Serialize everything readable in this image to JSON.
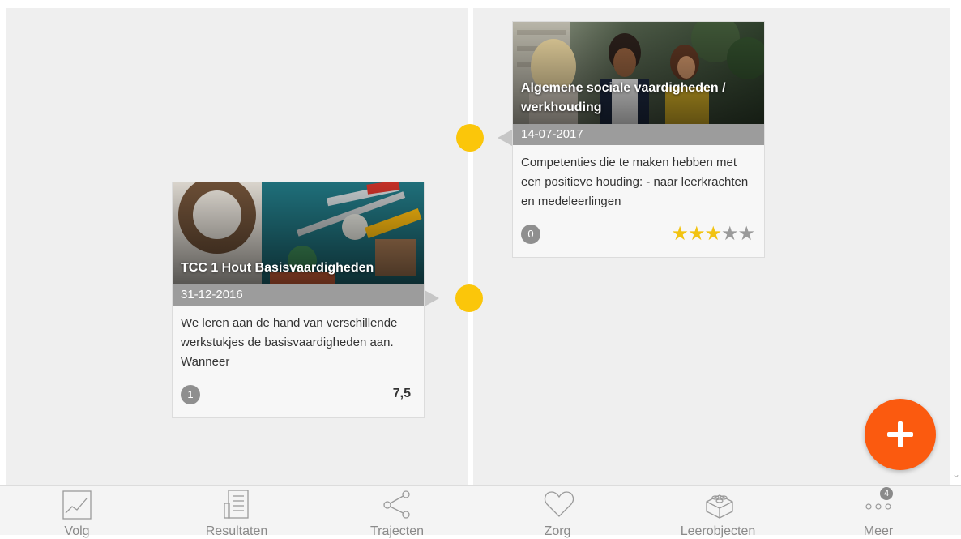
{
  "timeline": {
    "cards": [
      {
        "title": "Algemene sociale vaardigheden / werkhouding",
        "date": "14-07-2017",
        "description": "Competenties die te maken hebben met een positieve houding: - naar leerkrachten en medeleerlingen",
        "count": "0",
        "rating": 3,
        "rating_max": 5
      },
      {
        "title": "TCC 1 Hout Basisvaardigheden",
        "date": "31-12-2016",
        "description": "We leren aan de hand van verschillende werkstukjes de basisvaardigheden aan. Wanneer",
        "count": "1",
        "score": "7,5"
      }
    ],
    "dot_color": "#fbc60a"
  },
  "fab": {
    "icon": "plus-icon",
    "color": "#fb5a0f"
  },
  "bottom_nav": {
    "items": [
      {
        "label": "Volg",
        "icon": "chart-icon"
      },
      {
        "label": "Resultaten",
        "icon": "document-icon"
      },
      {
        "label": "Trajecten",
        "icon": "share-icon"
      },
      {
        "label": "Zorg",
        "icon": "heart-icon"
      },
      {
        "label": "Leerobjecten",
        "icon": "building-block-icon"
      },
      {
        "label": "Meer",
        "icon": "more-dots-icon",
        "badge": "4"
      }
    ]
  },
  "colors": {
    "accent": "#fb5a0f",
    "timeline_dot": "#fbc60a",
    "star_on": "#f2c311",
    "star_off": "#9a9a9a"
  }
}
